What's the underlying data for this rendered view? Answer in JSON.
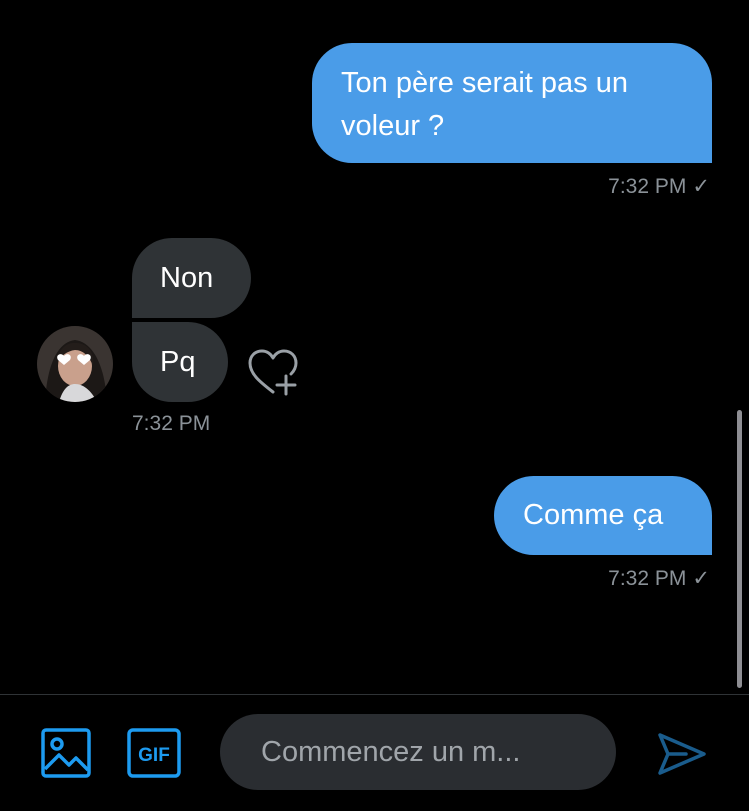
{
  "colors": {
    "background": "#000000",
    "outgoing_bubble": "#4a9ce8",
    "incoming_bubble": "#2f3336",
    "accent": "#1d9bf0",
    "timestamp": "#8b9298"
  },
  "messages": [
    {
      "direction": "outgoing",
      "lines": [
        "Ton père serait pas un",
        "voleur ?"
      ],
      "time": "7:32 PM",
      "status_icon": "check-icon",
      "status_glyph": "✓"
    },
    {
      "direction": "incoming",
      "text": "Non"
    },
    {
      "direction": "incoming",
      "text": "Pq",
      "time": "7:32 PM",
      "reaction_icon": "heart-plus-icon"
    },
    {
      "direction": "outgoing",
      "text": "Comme ça",
      "time": "7:32 PM",
      "status_icon": "check-icon",
      "status_glyph": "✓"
    }
  ],
  "composer": {
    "image_icon": "image-icon",
    "gif_label": "GIF",
    "placeholder": "Commencez un m...",
    "value": "",
    "send_icon": "send-icon"
  }
}
